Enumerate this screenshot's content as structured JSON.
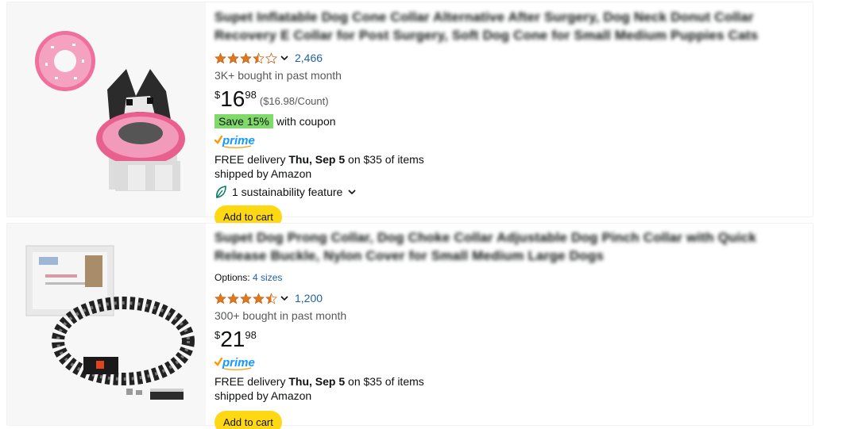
{
  "products": [
    {
      "title": "Supet Inflatable Dog Cone Collar Alternative After Surgery, Dog Neck Donut Collar Recovery E Collar for Post Surgery, Soft Dog Cone for Small Medium Puppies Cats",
      "rating_count": "2,466",
      "rating_stars": 3.5,
      "bought": "3K+ bought in past month",
      "price_symbol": "$",
      "price_whole": "16",
      "price_fraction": "98",
      "unit_price": "($16.98/Count)",
      "coupon_badge": "Save 15%",
      "coupon_text": "with coupon",
      "prime_label": "prime",
      "delivery_prefix": "FREE delivery ",
      "delivery_date": "Thu, Sep 5",
      "delivery_suffix": " on $35 of items",
      "shipped_by": "shipped by Amazon",
      "sustainability": "1 sustainability feature",
      "add_to_cart": "Add to cart"
    },
    {
      "title": "Supet Dog Prong Collar, Dog Choke Collar Adjustable Dog Pinch Collar with Quick Release Buckle, Nylon Cover for Small Medium Large Dogs",
      "options_label": "Options:",
      "options_value": "4 sizes",
      "rating_count": "1,200",
      "rating_stars": 4.5,
      "bought": "300+ bought in past month",
      "price_symbol": "$",
      "price_whole": "21",
      "price_fraction": "98",
      "prime_label": "prime",
      "delivery_prefix": "FREE delivery ",
      "delivery_date": "Thu, Sep 5",
      "delivery_suffix": " on $35 of items",
      "shipped_by": "shipped by Amazon",
      "add_to_cart": "Add to cart"
    }
  ],
  "colors": {
    "star": "#de7921",
    "link": "#2162a1",
    "coupon": "#7fda69",
    "cart_button": "#ffd814",
    "prime_blue": "#1399ff"
  },
  "icons": [
    "star-icon",
    "chevron-down-icon",
    "leaf-icon",
    "prime-logo"
  ]
}
